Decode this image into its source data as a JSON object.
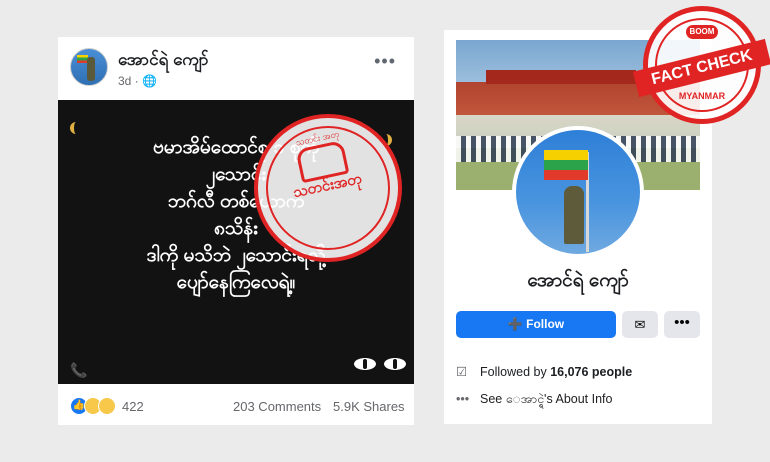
{
  "post": {
    "page_name": "အောင်ရဲ ကျော်",
    "time": "3d · ",
    "globe_icon": "globe-icon",
    "more": "•••",
    "image_text": [
      "ဗမာအိမ်ထောင်စု ၁ စုကို",
      "၂သောင်း",
      "ဘဂ်လီ တစ်ယောက်",
      "၈သိန်း",
      "ဒါကို မသိဘဲ ၂သောင်းရလို့",
      "ပျော်နေကြလေရဲ့။"
    ],
    "stamp_label": "သတင်းအတု",
    "stamp_arc": "သတင်း အတု",
    "reactions_count": "422",
    "comments": "203 Comments",
    "shares": "5.9K Shares"
  },
  "profile": {
    "name": "အောင်ရဲ ကျော်",
    "follow_label": "Follow",
    "messenger_icon": "messenger-icon",
    "more": "•••",
    "followed_prefix": "Followed by ",
    "followed_count": "16,076 people",
    "about_text": "See ေအာင္ရဲ's About Info"
  },
  "badge": {
    "top": "BOOM",
    "ribbon": "FACT CHECK",
    "bottom": "MYANMAR"
  },
  "colors": {
    "accent": "#1877f2",
    "stamp_red": "#e02424"
  }
}
